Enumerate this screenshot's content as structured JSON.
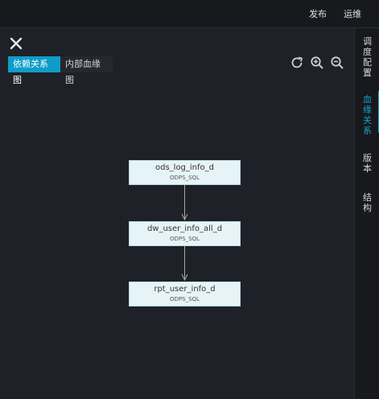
{
  "topbar": {
    "publish_label": "发布",
    "ops_label": "运维"
  },
  "panel": {
    "tabs": [
      {
        "label": "依赖关系图",
        "active": true
      },
      {
        "label": "内部血缘图",
        "active": false
      }
    ],
    "toolbar": {
      "refresh_icon": "refresh-icon",
      "zoom_in_icon": "zoom-in-icon",
      "zoom_out_icon": "zoom-out-icon"
    }
  },
  "graph": {
    "nodes": [
      {
        "name": "ods_log_info_d",
        "type": "ODPS_SQL"
      },
      {
        "name": "dw_user_info_all_d",
        "type": "ODPS_SQL"
      },
      {
        "name": "rpt_user_info_d",
        "type": "ODPS_SQL"
      }
    ]
  },
  "rightbar": {
    "tabs": [
      {
        "chars": [
          "调",
          "度",
          "配",
          "置"
        ],
        "active": false
      },
      {
        "chars": [
          "血",
          "缘",
          "关",
          "系"
        ],
        "active": true
      },
      {
        "chars": [
          "版",
          "本"
        ],
        "active": false
      },
      {
        "chars": [
          "结",
          "构"
        ],
        "active": false
      }
    ]
  },
  "colors": {
    "accent": "#0e9dc8",
    "active_text": "#15a3d0",
    "background": "#1e2127",
    "node_fill": "#e6f4f7"
  }
}
